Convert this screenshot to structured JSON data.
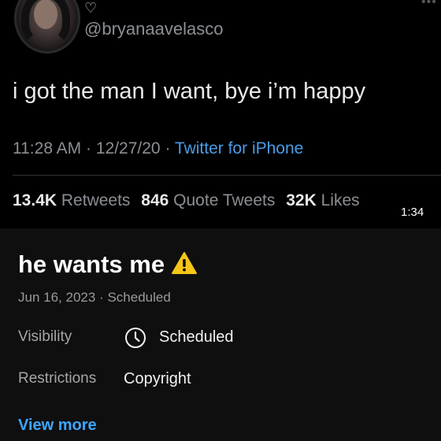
{
  "tweet": {
    "handle": "@bryanaavelasco",
    "text": "i got the man I want, bye i’m happy",
    "time": "11:28 AM",
    "date": "12/27/20",
    "source": "Twitter for iPhone",
    "retweets_count": "13.4K",
    "retweets_label": "Retweets",
    "quotes_count": "846",
    "quotes_label": "Quote Tweets",
    "likes_count": "32K",
    "likes_label": "Likes",
    "separator": "·",
    "heart_icon": "heart-icon",
    "more_icon": "more-dots-icon"
  },
  "video_time": "1:34",
  "details": {
    "title": "he wants me",
    "title_icon": "warning-icon",
    "date": "Jun 16, 2023",
    "separator": "·",
    "status": "Scheduled",
    "visibility_label": "Visibility",
    "visibility_value": "Scheduled",
    "visibility_icon": "clock-icon",
    "restrictions_label": "Restrictions",
    "restrictions_value": "Copyright",
    "view_more": "View more"
  },
  "colors": {
    "background": "#000000",
    "panel": "#0f0f0f",
    "link_blue": "#3ea6ff",
    "twitter_blue": "#4a9be8",
    "warning": "#f5c518"
  }
}
